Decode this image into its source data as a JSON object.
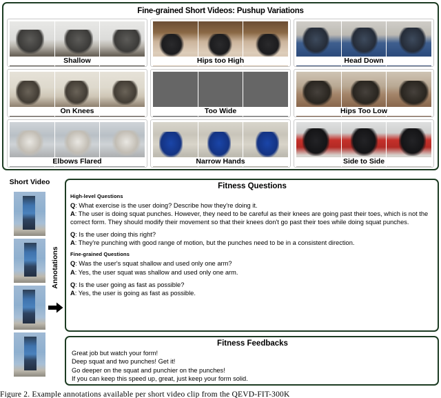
{
  "top_panel": {
    "title": "Fine-grained Short Videos: Pushup Variations",
    "rows": [
      [
        {
          "label": "Shallow",
          "style": "p-grayroom"
        },
        {
          "label": "Hips too High",
          "style": "p-wood2"
        },
        {
          "label": "Head Down",
          "style": "p-blue"
        }
      ],
      [
        {
          "label": "On Knees",
          "style": "p-white"
        },
        {
          "label": "Too Wide",
          "style": "p-wood"
        },
        {
          "label": "Hips Too Low",
          "style": "p-gymfloor"
        }
      ],
      [
        {
          "label": "Elbows Flared",
          "style": "p-office"
        },
        {
          "label": "Narrow Hands",
          "style": "p-hall"
        },
        {
          "label": "Side to Side",
          "style": "p-redsofa"
        }
      ]
    ]
  },
  "short_video": {
    "title": "Short Video",
    "annotations_label": "Annotations",
    "frame_count": 4
  },
  "questions_panel": {
    "title": "Fitness Questions",
    "sections": [
      {
        "heading": "High-level Questions",
        "qa": [
          {
            "q_label": "Q",
            "q": ": What exercise is the user doing? Describe how they're doing it.",
            "a_label": "A",
            "a": ": The user is doing squat punches. However, they need to be careful as their knees are going past their toes, which is not the correct form. They should modify their movement so that their knees don't go past their toes while doing squat punches."
          },
          {
            "q_label": "Q",
            "q": ": Is the user doing this right?",
            "a_label": "A",
            "a": ": They're punching with good range of motion, but the punches need to be in a consistent direction."
          }
        ]
      },
      {
        "heading": "Fine-grained Questions",
        "qa": [
          {
            "q_label": "Q",
            "q": ": Was the user's squat shallow and used only one arm?",
            "a_label": "A",
            "a": ": Yes, the user squat was shallow and used only one arm."
          },
          {
            "q_label": "Q",
            "q": ": Is the user going as fast as possible?",
            "a_label": "A",
            "a": ": Yes, the user is going as fast as possible."
          }
        ]
      }
    ]
  },
  "feedback_panel": {
    "title": "Fitness Feedbacks",
    "lines": [
      "Great job but watch your form!",
      "Deep squat and two punches! Get it!",
      "Go deeper on the squat and punchier on the punches!",
      "If you can keep this speed up, great, just keep your form solid."
    ]
  },
  "caption": "Figure 2.   Example annotations available per short video clip from the QEVD-FIT-300K",
  "colors": {
    "panel_border": "#1c3b22",
    "cell_border": "#c9c9c9",
    "text": "#000000"
  }
}
